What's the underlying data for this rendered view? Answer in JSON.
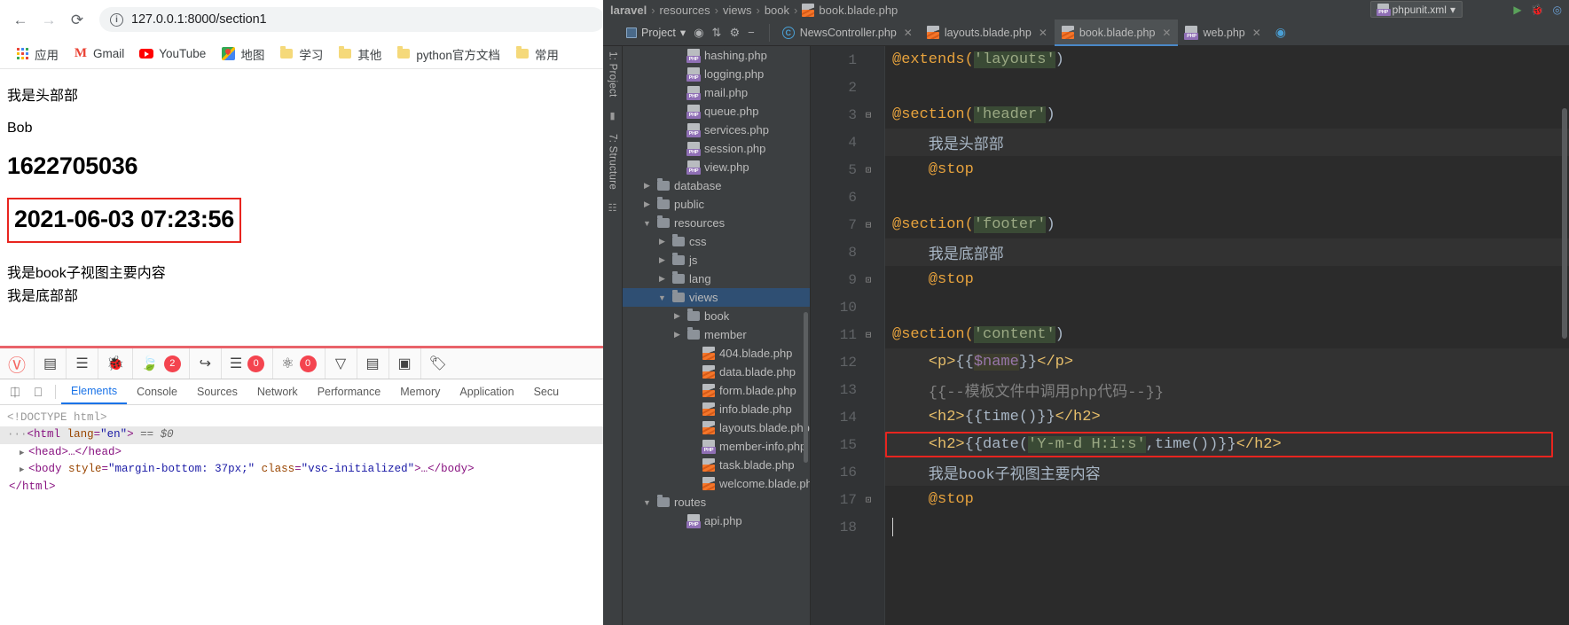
{
  "browser": {
    "nav": {
      "back": "←",
      "forward": "→",
      "reload": "⟳"
    },
    "omnibox": {
      "info_icon": "ⓘ",
      "url": "127.0.0.1:8000/section1"
    },
    "bookmarks": [
      {
        "label": "应用",
        "icon": "apps-grid-icon"
      },
      {
        "label": "Gmail",
        "icon": "gmail-icon"
      },
      {
        "label": "YouTube",
        "icon": "youtube-icon"
      },
      {
        "label": "地图",
        "icon": "maps-icon"
      },
      {
        "label": "学习",
        "icon": "folder-icon"
      },
      {
        "label": "其他",
        "icon": "folder-icon"
      },
      {
        "label": "python官方文档",
        "icon": "folder-icon"
      },
      {
        "label": "常用",
        "icon": "folder-icon"
      }
    ],
    "page": {
      "header_text": "我是头部部",
      "name": "Bob",
      "timestamp": "1622705036",
      "formatted_date": "2021-06-03 07:23:56",
      "content_text": "我是book子视图主要内容",
      "footer_text": "我是底部部"
    }
  },
  "debugbar": {
    "brand_icon": "laravel-icon",
    "items": [
      {
        "icon": "messages-icon",
        "badge": null
      },
      {
        "icon": "timeline-icon",
        "badge": null
      },
      {
        "icon": "exceptions-bug-icon",
        "badge": null
      },
      {
        "icon": "views-leaf-icon",
        "badge": "2"
      },
      {
        "icon": "route-arrow-icon",
        "badge": null
      },
      {
        "icon": "queries-database-icon",
        "badge": "0"
      },
      {
        "icon": "models-icon",
        "badge": "0"
      },
      {
        "icon": "mails-inbox-icon",
        "badge": null
      },
      {
        "icon": "session-icon",
        "badge": null
      },
      {
        "icon": "request-icon",
        "badge": null
      },
      {
        "icon": "tags-icon",
        "badge": null
      }
    ]
  },
  "devtools": {
    "inspect_icon": "cursor-select-icon",
    "device_icon": "device-toolbar-icon",
    "tabs": [
      {
        "label": "Elements",
        "active": true
      },
      {
        "label": "Console",
        "active": false
      },
      {
        "label": "Sources",
        "active": false
      },
      {
        "label": "Network",
        "active": false
      },
      {
        "label": "Performance",
        "active": false
      },
      {
        "label": "Memory",
        "active": false
      },
      {
        "label": "Application",
        "active": false
      },
      {
        "label": "Secu",
        "active": false
      }
    ],
    "dom": {
      "doctype": "<!DOCTYPE html>",
      "html_open_prefix": "···",
      "html_tag_lt": "<",
      "html_tag_name": "html",
      "html_attr_name": "lang",
      "html_attr_eq": "=",
      "html_attr_val": "\"en\"",
      "html_tag_gt": ">",
      "html_selected_marker": "== $0",
      "head_line": "<head>…</head>",
      "body_lt": "<body ",
      "body_attr1_name": "style",
      "body_attr1_val": "\"margin-bottom: 37px;\"",
      "body_attr2_name": "class",
      "body_attr2_val": "\"vsc-initialized\"",
      "body_rest": ">…</body>",
      "html_close": "</html>"
    }
  },
  "ide": {
    "breadcrumb": {
      "parts": [
        "laravel",
        "resources",
        "views",
        "book"
      ],
      "file": "book.blade.php",
      "separator": "›"
    },
    "run_config": {
      "label": "phpunit.xml",
      "caret": "▾"
    },
    "toolbar": {
      "project_label": "Project",
      "project_caret": "▾",
      "locate_icon": "locate-target-icon",
      "collapse_icon": "collapse-all-icon",
      "settings_icon": "gear-icon",
      "hide_icon": "minimize-icon"
    },
    "editor_tabs": [
      {
        "label": "NewsController.php",
        "icon": "php-class-icon",
        "active": false,
        "close": "✕"
      },
      {
        "label": "layouts.blade.php",
        "icon": "blade-icon",
        "active": false,
        "close": "✕"
      },
      {
        "label": "book.blade.php",
        "icon": "blade-icon",
        "active": true,
        "close": "✕"
      },
      {
        "label": "web.php",
        "icon": "php-icon",
        "active": false,
        "close": "✕"
      }
    ],
    "vertical_bars": [
      {
        "label": "1: Project",
        "icon": "project-icon"
      },
      {
        "label": "7: Structure",
        "icon": "structure-icon"
      }
    ],
    "tree": [
      {
        "label": "hashing.php",
        "depth": 3,
        "type": "php",
        "twisty": "",
        "selected": false
      },
      {
        "label": "logging.php",
        "depth": 3,
        "type": "php",
        "twisty": "",
        "selected": false
      },
      {
        "label": "mail.php",
        "depth": 3,
        "type": "php",
        "twisty": "",
        "selected": false
      },
      {
        "label": "queue.php",
        "depth": 3,
        "type": "php",
        "twisty": "",
        "selected": false
      },
      {
        "label": "services.php",
        "depth": 3,
        "type": "php",
        "twisty": "",
        "selected": false
      },
      {
        "label": "session.php",
        "depth": 3,
        "type": "php",
        "twisty": "",
        "selected": false
      },
      {
        "label": "view.php",
        "depth": 3,
        "type": "php",
        "twisty": "",
        "selected": false
      },
      {
        "label": "database",
        "depth": 1,
        "type": "folder",
        "twisty": "▶",
        "selected": false
      },
      {
        "label": "public",
        "depth": 1,
        "type": "folder",
        "twisty": "▶",
        "selected": false
      },
      {
        "label": "resources",
        "depth": 1,
        "type": "folder",
        "twisty": "▼",
        "selected": false
      },
      {
        "label": "css",
        "depth": 2,
        "type": "folder",
        "twisty": "▶",
        "selected": false
      },
      {
        "label": "js",
        "depth": 2,
        "type": "folder",
        "twisty": "▶",
        "selected": false
      },
      {
        "label": "lang",
        "depth": 2,
        "type": "folder",
        "twisty": "▶",
        "selected": false
      },
      {
        "label": "views",
        "depth": 2,
        "type": "folder",
        "twisty": "▼",
        "selected": true
      },
      {
        "label": "book",
        "depth": 3,
        "type": "folder",
        "twisty": "▶",
        "selected": false
      },
      {
        "label": "member",
        "depth": 3,
        "type": "folder",
        "twisty": "▶",
        "selected": false
      },
      {
        "label": "404.blade.php",
        "depth": 4,
        "type": "blade",
        "twisty": "",
        "selected": false
      },
      {
        "label": "data.blade.php",
        "depth": 4,
        "type": "blade",
        "twisty": "",
        "selected": false
      },
      {
        "label": "form.blade.php",
        "depth": 4,
        "type": "blade",
        "twisty": "",
        "selected": false
      },
      {
        "label": "info.blade.php",
        "depth": 4,
        "type": "blade",
        "twisty": "",
        "selected": false
      },
      {
        "label": "layouts.blade.php",
        "depth": 4,
        "type": "blade",
        "twisty": "",
        "selected": false
      },
      {
        "label": "member-info.php",
        "depth": 4,
        "type": "php",
        "twisty": "",
        "selected": false
      },
      {
        "label": "task.blade.php",
        "depth": 4,
        "type": "blade",
        "twisty": "",
        "selected": false
      },
      {
        "label": "welcome.blade.php",
        "depth": 4,
        "type": "blade",
        "twisty": "",
        "selected": false
      },
      {
        "label": "routes",
        "depth": 1,
        "type": "folder",
        "twisty": "▼",
        "selected": false
      },
      {
        "label": "api.php",
        "depth": 3,
        "type": "php",
        "twisty": "",
        "selected": false
      }
    ],
    "code": {
      "file": "book.blade.php",
      "lines": [
        {
          "n": "1",
          "fold": "",
          "highlight": false,
          "segments": [
            {
              "t": "@extends(",
              "c": "at"
            },
            {
              "t": "'layouts'",
              "c": "str"
            },
            {
              "t": ")",
              "c": "plain"
            }
          ]
        },
        {
          "n": "2",
          "fold": "",
          "highlight": false,
          "segments": []
        },
        {
          "n": "3",
          "fold": "⊟",
          "highlight": false,
          "segments": [
            {
              "t": "@section(",
              "c": "at"
            },
            {
              "t": "'header'",
              "c": "str"
            },
            {
              "t": ")",
              "c": "plain"
            }
          ]
        },
        {
          "n": "4",
          "fold": "",
          "highlight": true,
          "segments": [
            {
              "t": "    我是头部部",
              "c": "cjk"
            }
          ]
        },
        {
          "n": "5",
          "fold": "⊡",
          "highlight": false,
          "segments": [
            {
              "t": "    @stop",
              "c": "at"
            }
          ]
        },
        {
          "n": "6",
          "fold": "",
          "highlight": false,
          "segments": []
        },
        {
          "n": "7",
          "fold": "⊟",
          "highlight": false,
          "segments": [
            {
              "t": "@section(",
              "c": "at"
            },
            {
              "t": "'footer'",
              "c": "str"
            },
            {
              "t": ")",
              "c": "plain"
            }
          ]
        },
        {
          "n": "8",
          "fold": "",
          "highlight": true,
          "segments": [
            {
              "t": "    我是底部部",
              "c": "cjk"
            }
          ]
        },
        {
          "n": "9",
          "fold": "⊡",
          "highlight": false,
          "segments": [
            {
              "t": "    @stop",
              "c": "at"
            }
          ]
        },
        {
          "n": "10",
          "fold": "",
          "highlight": false,
          "segments": []
        },
        {
          "n": "11",
          "fold": "⊟",
          "highlight": false,
          "segments": [
            {
              "t": "@section(",
              "c": "at"
            },
            {
              "t": "'content'",
              "c": "str"
            },
            {
              "t": ")",
              "c": "plain"
            }
          ]
        },
        {
          "n": "12",
          "fold": "",
          "highlight": true,
          "segments": [
            {
              "t": "    ",
              "c": "plain"
            },
            {
              "t": "<p>",
              "c": "tag"
            },
            {
              "t": "{{",
              "c": "plain"
            },
            {
              "t": "$name",
              "c": "var"
            },
            {
              "t": "}}",
              "c": "plain"
            },
            {
              "t": "</p>",
              "c": "tag"
            }
          ]
        },
        {
          "n": "13",
          "fold": "",
          "highlight": true,
          "segments": [
            {
              "t": "    {{--模板文件中调用php代码--}}",
              "c": "comment"
            }
          ]
        },
        {
          "n": "14",
          "fold": "",
          "highlight": true,
          "segments": [
            {
              "t": "    ",
              "c": "plain"
            },
            {
              "t": "<h2>",
              "c": "tag"
            },
            {
              "t": "{{",
              "c": "plain"
            },
            {
              "t": "time()",
              "c": "strplain"
            },
            {
              "t": "}}",
              "c": "plain"
            },
            {
              "t": "</h2>",
              "c": "tag"
            }
          ]
        },
        {
          "n": "15",
          "fold": "",
          "highlight": true,
          "boxed": true,
          "segments": [
            {
              "t": "    ",
              "c": "plain"
            },
            {
              "t": "<h2>",
              "c": "tag"
            },
            {
              "t": "{{",
              "c": "plain"
            },
            {
              "t": "date(",
              "c": "strplain"
            },
            {
              "t": "'Y-m-d H:i:s'",
              "c": "str"
            },
            {
              "t": ",time())",
              "c": "strplain"
            },
            {
              "t": "}}",
              "c": "plain"
            },
            {
              "t": "</h2>",
              "c": "tag"
            }
          ]
        },
        {
          "n": "16",
          "fold": "",
          "highlight": true,
          "segments": [
            {
              "t": "    我是book子视图主要内容",
              "c": "cjk"
            }
          ]
        },
        {
          "n": "17",
          "fold": "⊡",
          "highlight": false,
          "segments": [
            {
              "t": "    @stop",
              "c": "at"
            }
          ]
        },
        {
          "n": "18",
          "fold": "",
          "highlight": false,
          "segments": [],
          "caret": true
        }
      ]
    }
  },
  "colors": {
    "accent_red": "#e8251f",
    "debugbar_red": "#e9636a",
    "devtools_blue": "#1a73e8",
    "ide_bg": "#3c3f41",
    "editor_bg": "#2b2b2b",
    "ide_selection": "#2f4f73"
  }
}
